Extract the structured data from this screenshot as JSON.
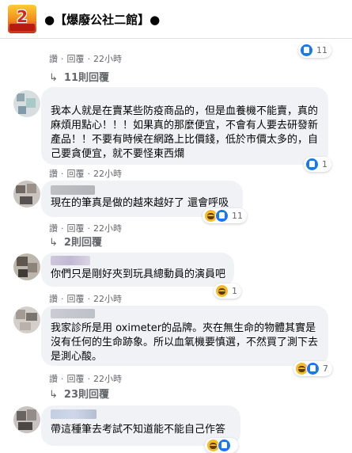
{
  "header": {
    "title": "●【爆廢公社二館】●",
    "logo_number": "2"
  },
  "top_actions": {
    "like": "讚",
    "reply": "回覆",
    "time": "22小時",
    "reactions": [
      "like"
    ],
    "reaction_count": "11"
  },
  "top_replies": "11則回覆",
  "comments": [
    {
      "text": "我本人就是在賣某些防疫商品的，但是血養機不能賣，真的麻煩用點心！！！如果真的那麼便宜，不會有人要去研發新產品！！不要有時候在網路上比價錢，低於市價太多的，自己要貪便宜，就不要怪東西爛",
      "like": "讚",
      "reply": "回覆",
      "time": "22小時",
      "reactions": [
        "like"
      ],
      "reaction_count": "1",
      "replies": ""
    },
    {
      "text": "現在的筆真是做的越來越好了 還會呼吸",
      "like": "讚",
      "reply": "回覆",
      "time": "22小時",
      "reactions": [
        "haha",
        "like"
      ],
      "reaction_count": "11",
      "replies": "2則回覆"
    },
    {
      "text": "你們只是剛好夾到玩具總動員的演員吧",
      "like": "讚",
      "reply": "回覆",
      "time": "22小時",
      "reactions": [
        "haha"
      ],
      "reaction_count": "1",
      "replies": ""
    },
    {
      "text": "我家診所是用 oximeter的品牌。夾在無生命的物體其實是沒有任何的生命跡象。所以血氧機要慎選，不然買了測下去是測心酸。",
      "like": "讚",
      "reply": "回覆",
      "time": "22小時",
      "reactions": [
        "haha",
        "like"
      ],
      "reaction_count": "7",
      "replies": "23則回覆"
    },
    {
      "text": "帶這種筆去考試不知道能不能自己作答",
      "like": "",
      "reply": "",
      "time": "",
      "reactions": [
        "haha",
        "like"
      ],
      "reaction_count": "",
      "replies": ""
    }
  ],
  "colors": {
    "link_gray": "#65676b",
    "bubble": "#f0f2f5",
    "like_blue": "#1877f2",
    "haha_yellow": "#f7b928"
  }
}
